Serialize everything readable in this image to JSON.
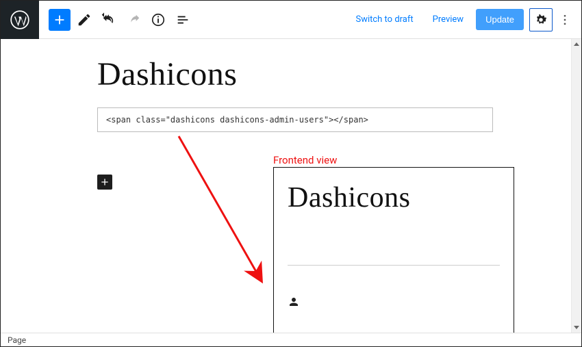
{
  "toolbar": {
    "switch_to_draft": "Switch to draft",
    "preview": "Preview",
    "update": "Update"
  },
  "editor": {
    "page_title": "Dashicons",
    "code_block": "<span class=\"dashicons dashicons-admin-users\"></span>"
  },
  "annotation": {
    "frontend_label": "Frontend view"
  },
  "frontend": {
    "title": "Dashicons",
    "icon_name": "admin-users"
  },
  "footer": {
    "breadcrumb": "Page"
  }
}
